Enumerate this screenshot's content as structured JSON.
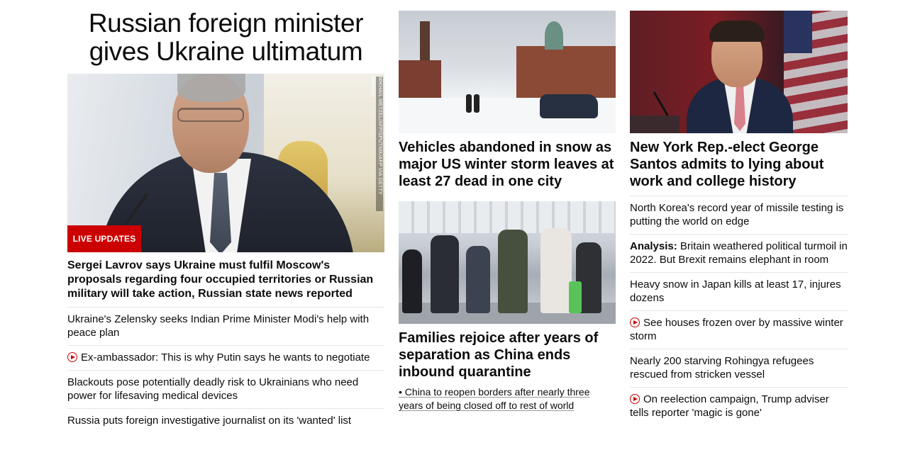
{
  "lead": {
    "headline": "Russian foreign minister gives Ukraine ultimatum",
    "photo_credit": "MIKHAIL METZEL/AFP/SPUTNIK/AFP VIA GETTY IMAGES",
    "badge": "LIVE UPDATES",
    "summary": "Sergei Lavrov says Ukraine must fulfil Moscow's proposals regarding four occupied territories or Russian military will take action, Russian state news reported",
    "related": [
      {
        "text": "Ukraine's Zelensky seeks Indian Prime Minister Modi's help with peace plan",
        "video": false
      },
      {
        "text": "Ex-ambassador: This is why Putin says he wants to negotiate",
        "video": true
      },
      {
        "text": "Blackouts pose potentially deadly risk to Ukrainians who need power for lifesaving medical devices",
        "video": false
      },
      {
        "text": "Russia puts foreign investigative journalist on its 'wanted' list",
        "video": false
      }
    ]
  },
  "middle": {
    "story1": {
      "headline": "Vehicles abandoned in snow as major US winter storm leaves at least 27 dead in one city"
    },
    "story2": {
      "headline": "Families rejoice after years of separation as China ends inbound quarantine",
      "sub_link": "• China to reopen borders after nearly three years of being closed off to rest of world"
    }
  },
  "right": {
    "story": {
      "headline": "New York Rep.-elect George Santos admits to lying about work and college history"
    },
    "list": [
      {
        "prefix": "",
        "text": "North Korea's record year of missile testing is putting the world on edge",
        "video": false
      },
      {
        "prefix": "Analysis:",
        "text": " Britain weathered political turmoil in 2022. But Brexit remains elephant in room",
        "video": false
      },
      {
        "prefix": "",
        "text": "Heavy snow in Japan kills at least 17, injures dozens",
        "video": false
      },
      {
        "prefix": "",
        "text": "See houses frozen over by massive winter storm",
        "video": true
      },
      {
        "prefix": "",
        "text": "Nearly 200 starving Rohingya refugees rescued from stricken vessel",
        "video": false
      },
      {
        "prefix": "",
        "text": "On reelection campaign, Trump adviser tells reporter 'magic is gone'",
        "video": true
      }
    ]
  },
  "colors": {
    "accent_red": "#cc0000",
    "divider": "#e6e6e6",
    "text": "#0c0c0c"
  }
}
